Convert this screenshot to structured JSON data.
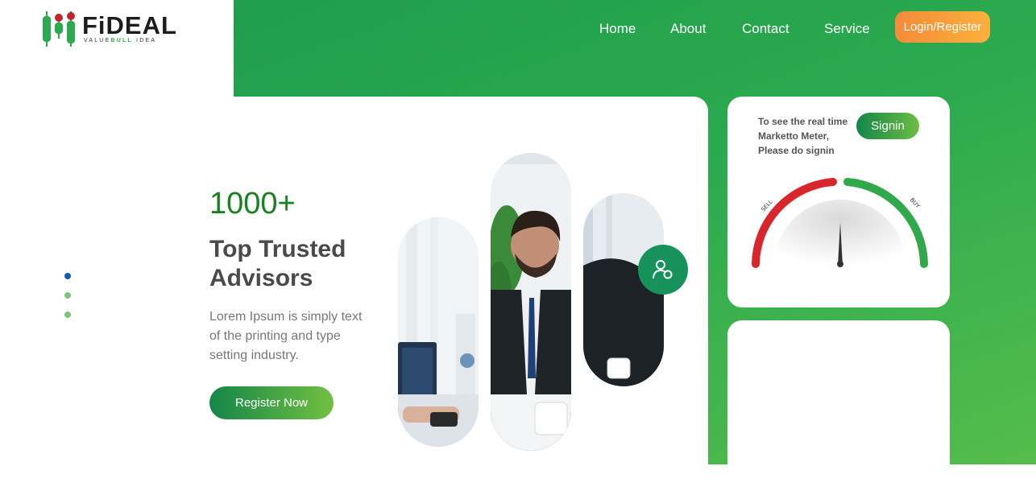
{
  "brand": {
    "name": "FiDEAL",
    "tagline_pre": "VALUE",
    "tagline_bold": "BULL",
    "tagline_post": " IDEA"
  },
  "nav": {
    "items": [
      {
        "label": "Home"
      },
      {
        "label": "About"
      },
      {
        "label": "Contact"
      },
      {
        "label": "Service"
      }
    ],
    "login_label": "Login/Register"
  },
  "slider": {
    "dots": 3,
    "active_index": 0
  },
  "hero": {
    "stat": "1000+",
    "headline": "Top Trusted Advisors",
    "description": "Lorem Ipsum is simply text of the printing and type setting industry.",
    "cta_label": "Register Now"
  },
  "meter": {
    "message": "To see the real time Marketto Meter, Please do signin",
    "signin_label": "Signin",
    "sell_label": "SELL",
    "buy_label": "BUY"
  },
  "colors": {
    "brand_green": "#2caa4f",
    "stat_green": "#17831f",
    "login_orange": "#f48b3a",
    "sell_red": "#d7262c",
    "buy_green": "#31a84a",
    "dot_active": "#1459b8",
    "dot_inactive": "#7cc47a"
  }
}
